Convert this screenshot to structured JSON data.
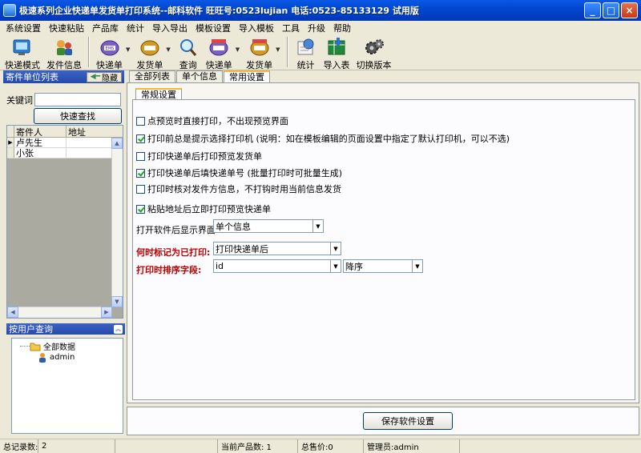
{
  "window": {
    "title": "极速系列企业快递单发货单打印系统--邮科软件 旺旺号:0523lujian 电话:0523-85133129 试用版",
    "min": "_",
    "max": "□",
    "close": "×"
  },
  "menu": [
    "系统设置",
    "快速粘贴",
    "产品库",
    "统计",
    "导入导出",
    "模板设置",
    "导入模板",
    "工具",
    "升级",
    "帮助"
  ],
  "toolbar": {
    "quick_mode": "快递模式",
    "send_info": "发件信息",
    "express1": "快递单",
    "delivery1": "发货单",
    "query": "查询",
    "express2": "快递单",
    "delivery2": "发货单",
    "stats": "统计",
    "import": "导入表",
    "switch_version": "切换版本",
    "arrow": "▼"
  },
  "left": {
    "sender_list_title": "寄件单位列表",
    "hide_label": "隐藏",
    "keyword_label": "关键词",
    "quick_search": "快速查找",
    "columns": [
      "寄件人",
      "地址"
    ],
    "rows": [
      {
        "marker": "▶",
        "name": "卢先生",
        "address": ""
      },
      {
        "marker": "",
        "name": "小张",
        "address": ""
      }
    ],
    "user_query_title": "按用户查询",
    "tree_all": "全部数据",
    "tree_admin": "admin"
  },
  "tabs": [
    "全部列表",
    "单个信息",
    "常用设置"
  ],
  "settings": {
    "subtab": "常规设置",
    "options": [
      {
        "label": "点预览时直接打印，不出现预览界面",
        "checked": false
      },
      {
        "label": "打印前总是提示选择打印机 (说明：如在模板编辑的页面设置中指定了默认打印机，可以不选)",
        "checked": true
      },
      {
        "label": "打印快递单后打印预览发货单",
        "checked": false
      },
      {
        "label": "打印快递单后填快递单号 (批量打印时可批量生成)",
        "checked": true
      },
      {
        "label": "打印时核对发件方信息，不打钩时用当前信息发货",
        "checked": false
      },
      {
        "label": "粘贴地址后立即打印预览快递单",
        "checked": true
      }
    ],
    "startup_label": "打开软件后显示界面",
    "startup_value": "单个信息",
    "mark_label": "何时标记为已打印:",
    "mark_value": "打印快递单后",
    "sort_label": "打印时排序字段:",
    "sort_field": "id",
    "sort_order": "降序",
    "save_button": "保存软件设置"
  },
  "status": {
    "total_label": "总记录数:",
    "total_value": "2",
    "products": "当前产品数: 1",
    "price": "总售价:0",
    "admin": "管理员:admin"
  }
}
